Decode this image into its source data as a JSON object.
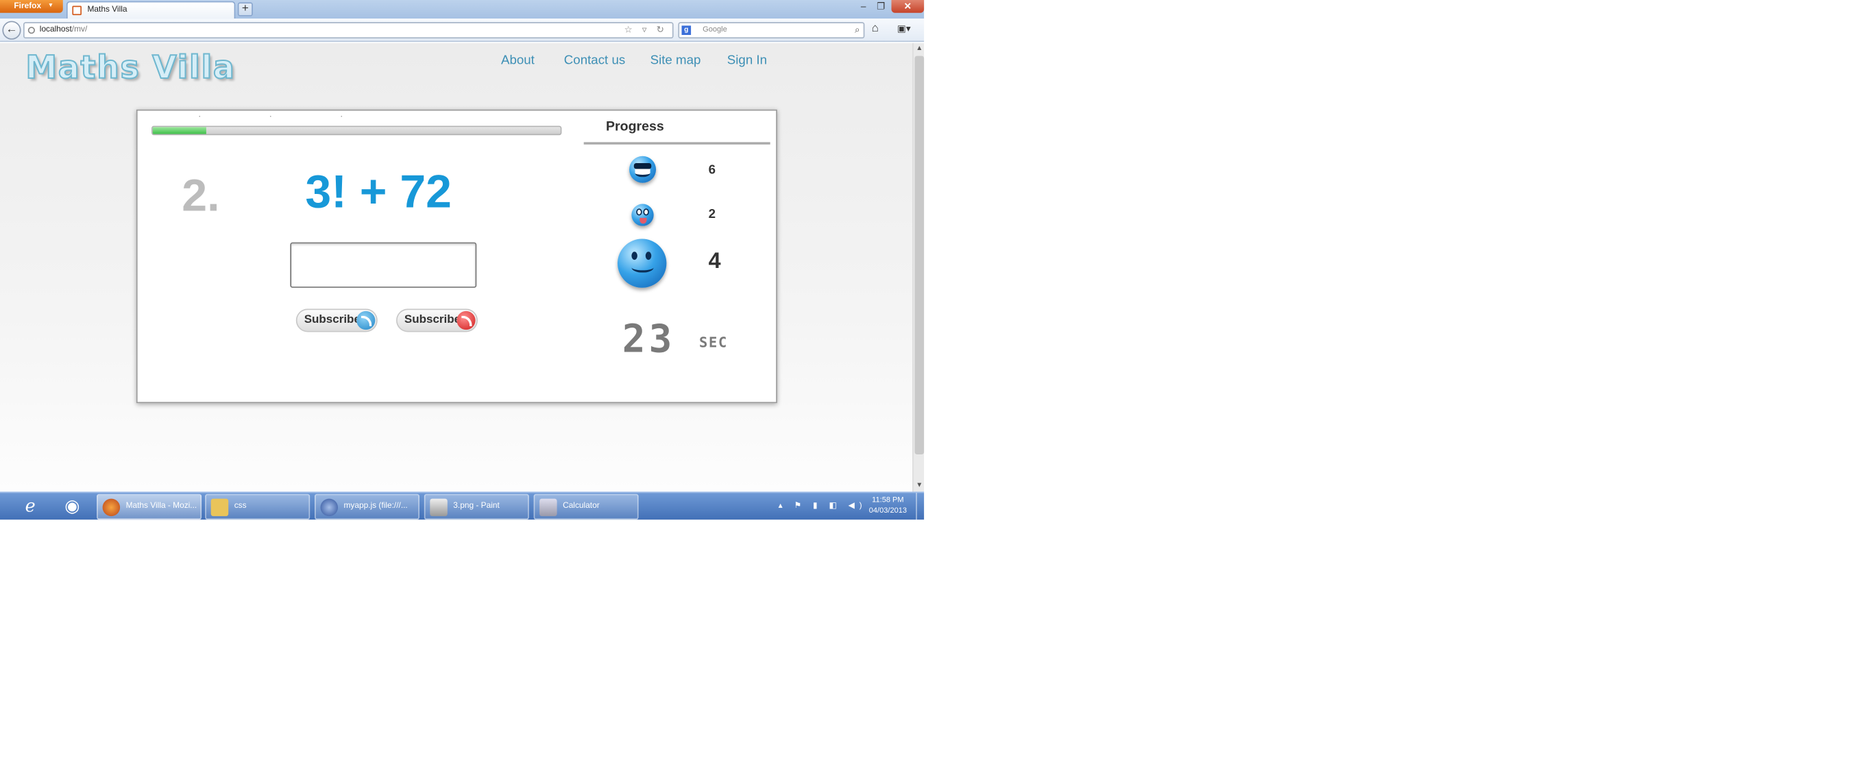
{
  "browser": {
    "app_button": "Firefox",
    "tab_title": "Maths Villa",
    "url_host": "localhost",
    "url_path": "/mv/",
    "search_placeholder": "Google"
  },
  "site": {
    "logo": "Maths Villa",
    "nav": [
      "About",
      "Contact us",
      "Site map",
      "Sign In"
    ]
  },
  "quiz": {
    "progress_fraction": 0.13,
    "question_number": "2.",
    "expression": "3! + 72",
    "answer_value": "",
    "subscribe_buttons": [
      "Subscribe",
      "Subscribe"
    ],
    "progress_heading": "Progress",
    "correct_count": "6",
    "wrong_count": "2",
    "total_count": "4",
    "timer_value": "23",
    "timer_unit": "SEC"
  },
  "taskbar": {
    "items": [
      {
        "label": "Maths Villa - Mozi..."
      },
      {
        "label": "css"
      },
      {
        "label": "myapp.js (file:///..."
      },
      {
        "label": "3.png - Paint"
      },
      {
        "label": "Calculator"
      }
    ],
    "time": "11:58 PM",
    "date": "04/03/2013"
  }
}
